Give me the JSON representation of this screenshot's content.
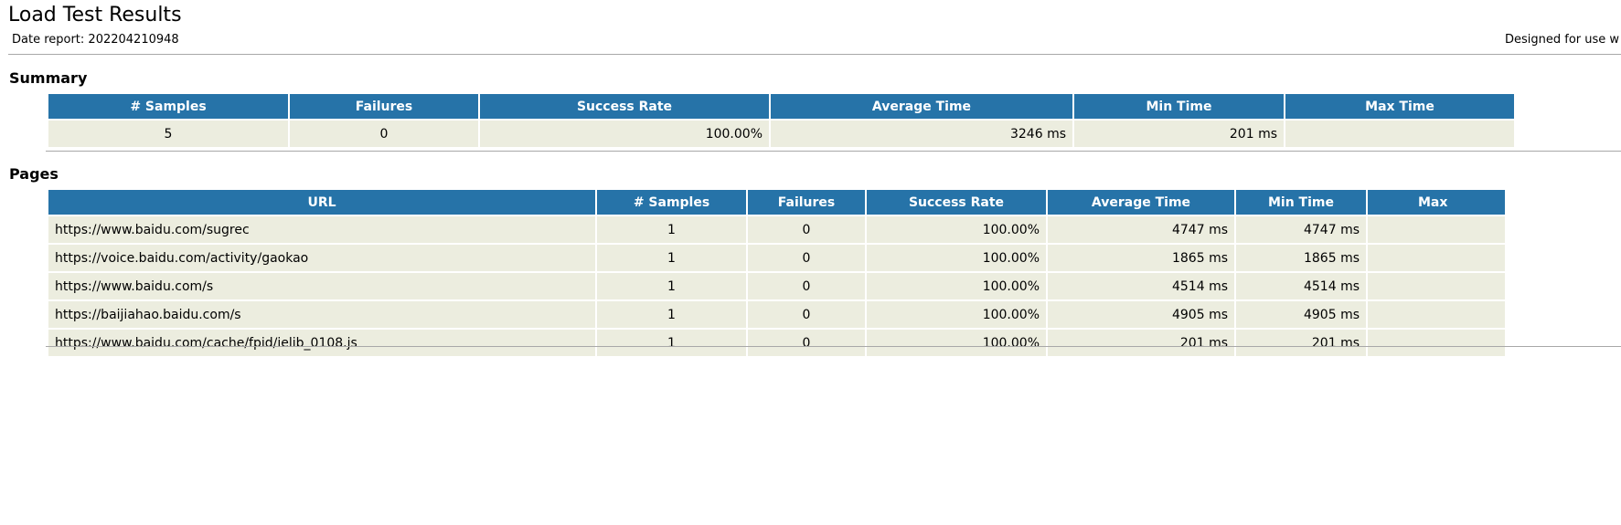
{
  "header": {
    "title": "Load Test Results",
    "date_report": "Date report: 202204210948",
    "designed_for": "Designed for use w"
  },
  "summary": {
    "heading": "Summary",
    "columns": [
      "# Samples",
      "Failures",
      "Success Rate",
      "Average Time",
      "Min Time",
      "Max Time"
    ],
    "row": {
      "samples": "5",
      "failures": "0",
      "success_rate": "100.00%",
      "average_time": "3246 ms",
      "min_time": "201 ms",
      "max_time": ""
    }
  },
  "pages": {
    "heading": "Pages",
    "columns": [
      "URL",
      "# Samples",
      "Failures",
      "Success Rate",
      "Average Time",
      "Min Time",
      "Max"
    ],
    "rows": [
      {
        "url": "https://www.baidu.com/sugrec",
        "samples": "1",
        "failures": "0",
        "success_rate": "100.00%",
        "average_time": "4747 ms",
        "min_time": "4747 ms",
        "max_time": ""
      },
      {
        "url": "https://voice.baidu.com/activity/gaokao",
        "samples": "1",
        "failures": "0",
        "success_rate": "100.00%",
        "average_time": "1865 ms",
        "min_time": "1865 ms",
        "max_time": ""
      },
      {
        "url": "https://www.baidu.com/s",
        "samples": "1",
        "failures": "0",
        "success_rate": "100.00%",
        "average_time": "4514 ms",
        "min_time": "4514 ms",
        "max_time": ""
      },
      {
        "url": "https://baijiahao.baidu.com/s",
        "samples": "1",
        "failures": "0",
        "success_rate": "100.00%",
        "average_time": "4905 ms",
        "min_time": "4905 ms",
        "max_time": ""
      },
      {
        "url": "https://www.baidu.com/cache/fpid/ielib_0108.js",
        "samples": "1",
        "failures": "0",
        "success_rate": "100.00%",
        "average_time": "201 ms",
        "min_time": "201 ms",
        "max_time": ""
      }
    ]
  },
  "colors": {
    "header_bg": "#2673a8",
    "cell_bg": "#eceddf",
    "rule": "#a8a8a8"
  }
}
